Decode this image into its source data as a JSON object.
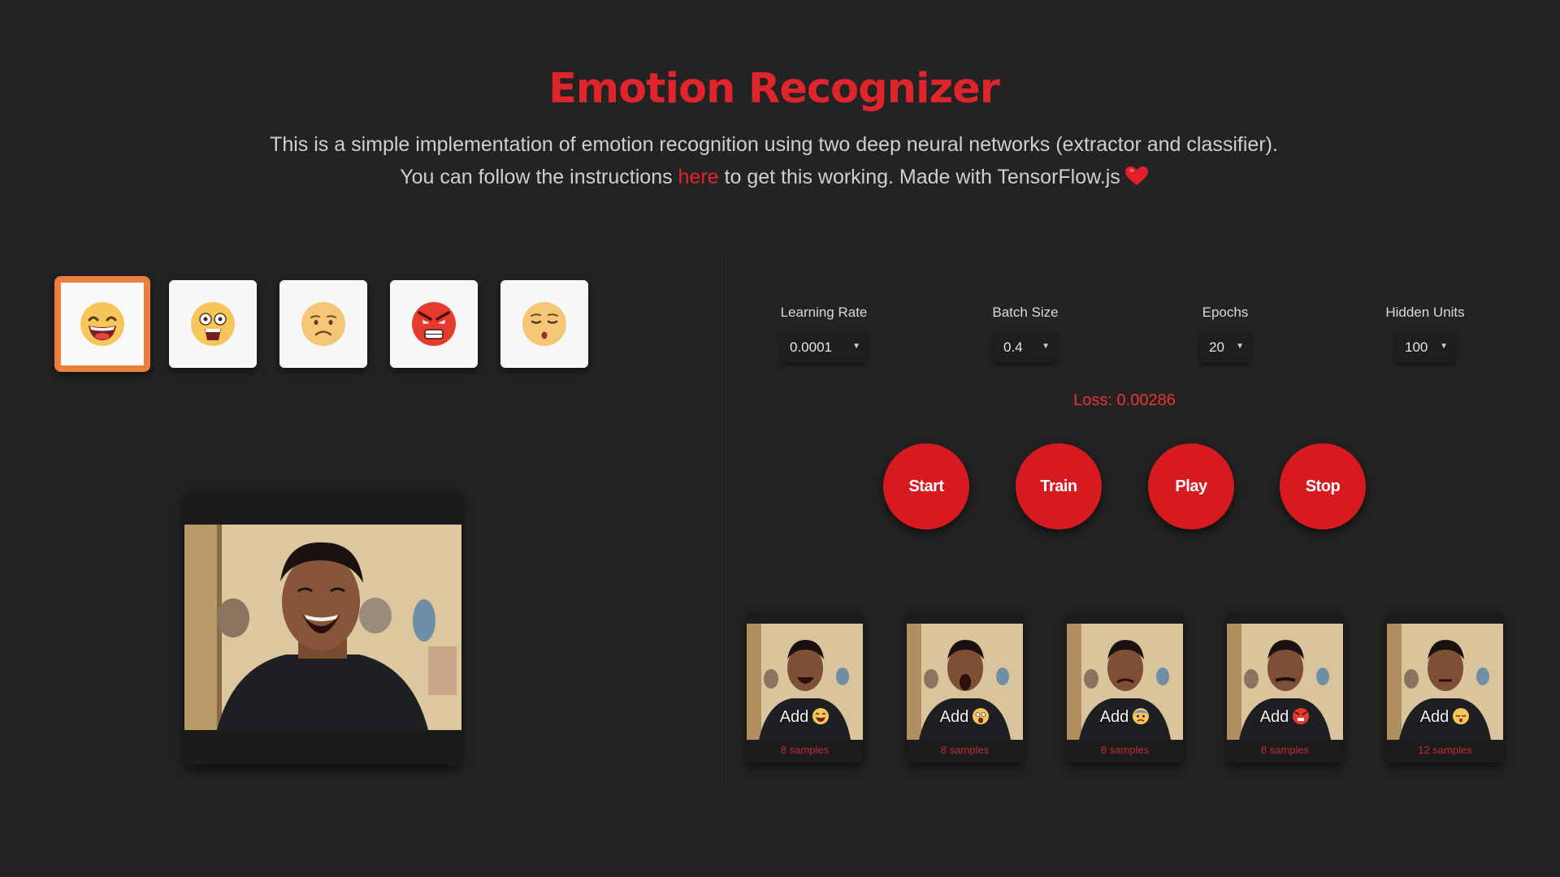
{
  "header": {
    "title": "Emotion Recognizer",
    "intro_line1": "This is a simple implementation of emotion recognition using two deep neural networks (extractor and classifier).",
    "intro_line2_before": "You can follow the instructions ",
    "intro_link": "here",
    "intro_line2_after": " to get this working. Made with TensorFlow.js",
    "heart_icon": "heart-icon"
  },
  "emotions": [
    {
      "name": "happy",
      "icon": "laughing-face-icon",
      "selected": true
    },
    {
      "name": "surprised",
      "icon": "shocked-face-icon",
      "selected": false
    },
    {
      "name": "sad",
      "icon": "sad-face-icon",
      "selected": false
    },
    {
      "name": "angry",
      "icon": "angry-face-icon",
      "selected": false
    },
    {
      "name": "neutral",
      "icon": "tired-face-icon",
      "selected": false
    }
  ],
  "controls": {
    "learning_rate": {
      "label": "Learning Rate",
      "value": "0.0001"
    },
    "batch_size": {
      "label": "Batch Size",
      "value": "0.4"
    },
    "epochs": {
      "label": "Epochs",
      "value": "20"
    },
    "hidden_units": {
      "label": "Hidden Units",
      "value": "100"
    },
    "arrow": "▼"
  },
  "loss_text": "Loss: 0.00286",
  "buttons": {
    "start": "Start",
    "train": "Train",
    "play": "Play",
    "stop": "Stop"
  },
  "samples": [
    {
      "add_label": "Add",
      "icon": "laughing-emoji-icon",
      "count": "8 samples"
    },
    {
      "add_label": "Add",
      "icon": "shocked-emoji-icon",
      "count": "8 samples"
    },
    {
      "add_label": "Add",
      "icon": "fearful-emoji-icon",
      "count": "8 samples"
    },
    {
      "add_label": "Add",
      "icon": "angry-emoji-icon",
      "count": "8 samples"
    },
    {
      "add_label": "Add",
      "icon": "tired-emoji-icon",
      "count": "12 samples"
    }
  ],
  "colors": {
    "background": "#232323",
    "accent_red": "#d71920",
    "title_red": "#e0242c",
    "selected_orange": "#ec7f3b"
  }
}
